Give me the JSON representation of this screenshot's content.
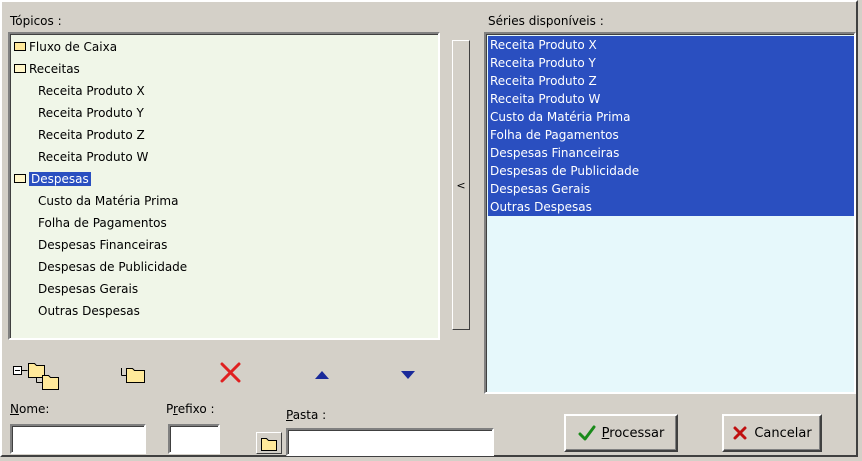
{
  "topics": {
    "label": "Tópicos :",
    "tree": [
      {
        "label": "Fluxo de Caixa",
        "icon": "folder-icon"
      },
      {
        "label": "Receitas",
        "icon": "folder-open-icon"
      },
      {
        "label": "Receita Produto X"
      },
      {
        "label": "Receita Produto Y"
      },
      {
        "label": "Receita Produto Z"
      },
      {
        "label": "Receita Produto W"
      },
      {
        "label": "Despesas",
        "icon": "folder-open-icon",
        "selected": true
      },
      {
        "label": "Custo da Matéria Prima"
      },
      {
        "label": "Folha de Pagamentos"
      },
      {
        "label": "Despesas Financeiras"
      },
      {
        "label": "Despesas de Publicidade"
      },
      {
        "label": "Despesas Gerais"
      },
      {
        "label": "Outras Despesas"
      }
    ]
  },
  "move_left_glyph": "<",
  "series": {
    "label": "Séries disponíveis :",
    "items": [
      "Receita Produto X",
      "Receita Produto Y",
      "Receita Produto Z",
      "Receita Produto W",
      "Custo da Matéria Prima",
      "Folha de Pagamentos",
      "Despesas Financeiras",
      "Despesas de Publicidade",
      "Despesas Gerais",
      "Outras Despesas"
    ]
  },
  "toolbar": {
    "new_group_icon": "new-folder-tree-icon",
    "new_folder_icon": "new-folder-icon",
    "delete_icon": "delete-x-icon",
    "up_icon": "arrow-up-icon",
    "down_icon": "arrow-down-icon"
  },
  "form": {
    "nome_label": "Nome:",
    "nome_value": "",
    "prefixo_label": "Prefixo :",
    "prefixo_value": "",
    "pasta_label": "Pasta :",
    "pasta_value": ""
  },
  "buttons": {
    "processar": "Processar",
    "cancelar": "Cancelar"
  },
  "colors": {
    "selection": "#2a4fc0",
    "delete_red": "#e02020",
    "arrow_blue": "#1a2a9a",
    "check_green": "#1a8a1a"
  }
}
